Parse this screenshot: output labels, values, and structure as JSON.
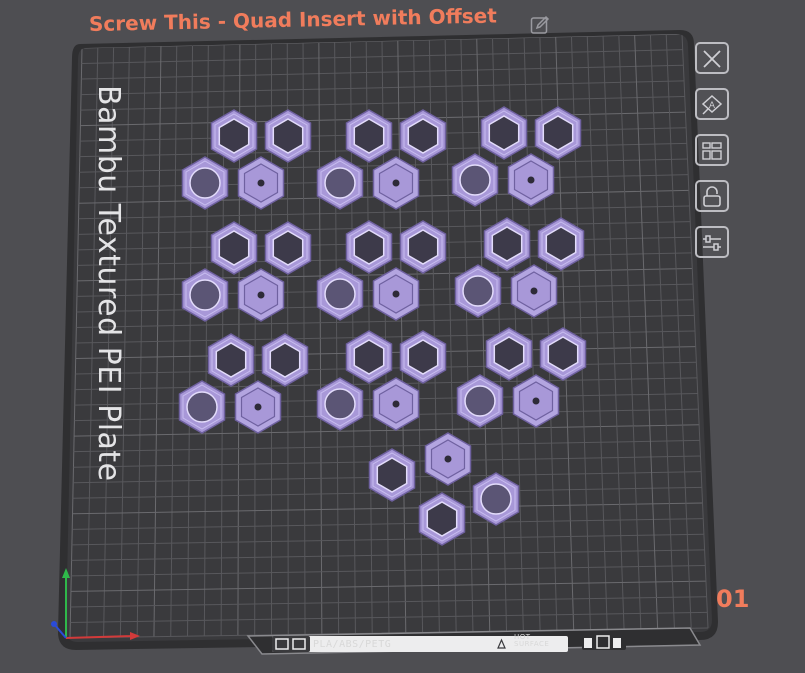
{
  "plate": {
    "title": "Screw This - Quad Insert with Offset",
    "brand_text": "Bambu Textured PEI Plate",
    "number": "01",
    "filament_label": "PLA/ABS/PETG",
    "hot_surface_label_line1": "HOT",
    "hot_surface_label_line2": "SURFACE"
  },
  "toolbar": {
    "items": [
      {
        "icon": "close-icon"
      },
      {
        "icon": "auto-orient-icon"
      },
      {
        "icon": "arrange-icon"
      },
      {
        "icon": "lock-icon"
      },
      {
        "icon": "plate-settings-icon"
      }
    ]
  },
  "colors": {
    "background": "#4e4e52",
    "plate": "#3a3a3d",
    "grid": "#5f5f63",
    "part": "#a898d8",
    "accent": "#f07c5c"
  },
  "parts": {
    "count": 10,
    "name": "quad hex insert"
  }
}
